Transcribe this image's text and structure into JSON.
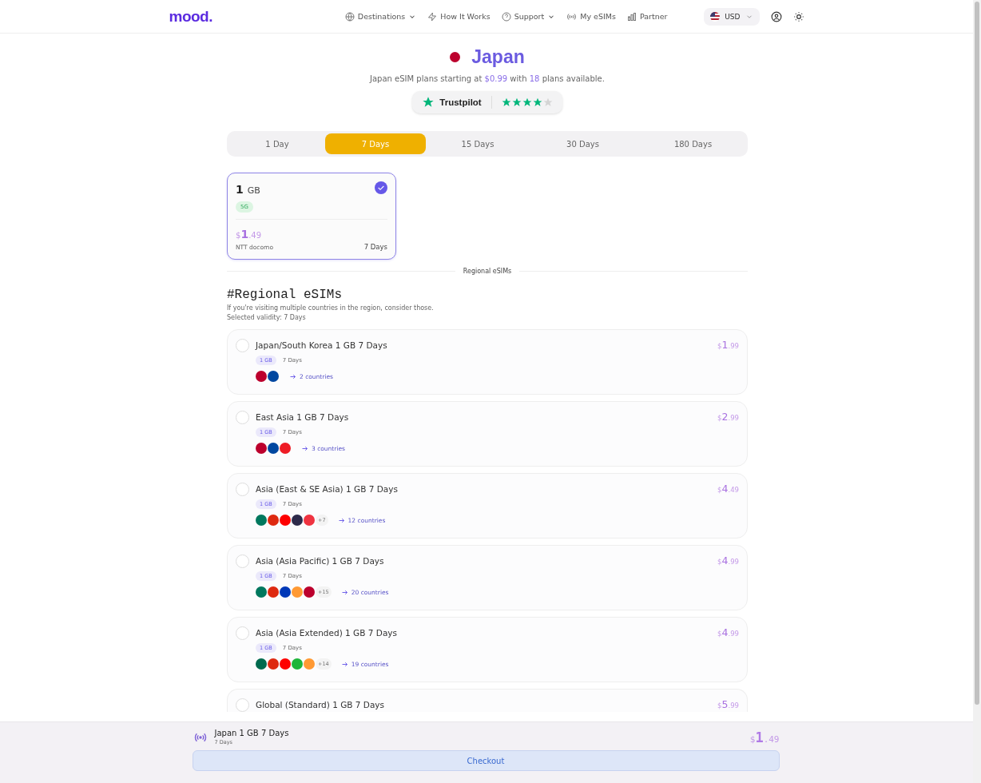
{
  "header": {
    "logo": "mood.",
    "nav": [
      {
        "label": "Destinations",
        "dropdown": true
      },
      {
        "label": "How It Works",
        "dropdown": false
      },
      {
        "label": "Support",
        "dropdown": true
      },
      {
        "label": "My eSIMs",
        "dropdown": false
      },
      {
        "label": "Partner",
        "dropdown": false
      }
    ],
    "currency": "USD"
  },
  "hero": {
    "country": "Japan",
    "subtitle": "Japan eSIM plans starting at **$0.99** with **18** plans available.",
    "trustpilot": {
      "label": "Trustpilot",
      "stars": 4
    }
  },
  "durations": [
    {
      "label": "1 Day",
      "selected": false
    },
    {
      "label": "7 Days",
      "selected": true
    },
    {
      "label": "15 Days",
      "selected": false
    },
    {
      "label": "30 Days",
      "selected": false
    },
    {
      "label": "180 Days",
      "selected": false
    }
  ],
  "plans": [
    {
      "data": "1",
      "unit": "GB",
      "network": "5G",
      "price": "$**1**.49",
      "operator": "NTT docomo",
      "validity": "7 Days",
      "selected": true
    }
  ],
  "divider_label": "Regional eSIMs",
  "regional": {
    "heading": "#Regional eSIMs",
    "description": "If you're visiting multiple countries in the region, consider those.",
    "validity_note": "Selected validity: 7 Days",
    "items": [
      {
        "title": "Japan/South Korea 1 GB 7 Days",
        "price": "$**1**.99",
        "data": "1 GB",
        "validity": "7 Days",
        "selected": false,
        "flags": [
          {
            "color": "#bc002d"
          },
          {
            "color": "#0047a0"
          }
        ],
        "countries": "2 countries"
      },
      {
        "title": "East Asia 1 GB 7 Days",
        "price": "$**2**.99",
        "data": "1 GB",
        "validity": "7 Days",
        "selected": false,
        "flags": [
          {
            "color": "#bc002d"
          },
          {
            "color": "#0047a0"
          },
          {
            "color": "#ee1c25"
          }
        ],
        "countries": "3 countries"
      },
      {
        "title": "Asia (East & SE Asia) 1 GB 7 Days",
        "price": "$**4**.49",
        "data": "1 GB",
        "validity": "7 Days",
        "selected": false,
        "flags": [
          {
            "color": "#00785e"
          },
          {
            "color": "#de2910"
          },
          {
            "color": "#fe0000"
          },
          {
            "color": "#2d2a4a"
          },
          {
            "color": "#ef3340"
          }
        ],
        "extra": "+7",
        "countries": "12 countries"
      },
      {
        "title": "Asia (Asia Pacific) 1 GB 7 Days",
        "price": "$**4**.99",
        "data": "1 GB",
        "validity": "7 Days",
        "selected": false,
        "flags": [
          {
            "color": "#00785e"
          },
          {
            "color": "#de2910"
          },
          {
            "color": "#0038b8"
          },
          {
            "color": "#ff9933"
          },
          {
            "color": "#bc002d"
          }
        ],
        "extra": "+15",
        "countries": "20 countries"
      },
      {
        "title": "Asia (Asia Extended) 1 GB 7 Days",
        "price": "$**4**.99",
        "data": "1 GB",
        "validity": "7 Days",
        "selected": false,
        "flags": [
          {
            "color": "#006a4e"
          },
          {
            "color": "#de2910"
          },
          {
            "color": "#fe0000"
          },
          {
            "color": "#1eb53a"
          },
          {
            "color": "#ff9933"
          }
        ],
        "extra": "+14",
        "countries": "19 countries"
      },
      {
        "title": "Global (Standard) 1 GB 7 Days",
        "price": "$**5**.99",
        "selected": false
      }
    ]
  },
  "summary": {
    "title": "Japan 1 GB 7 Days",
    "validity": "7 Days",
    "price": "$**1**.49",
    "button": "Checkout"
  }
}
